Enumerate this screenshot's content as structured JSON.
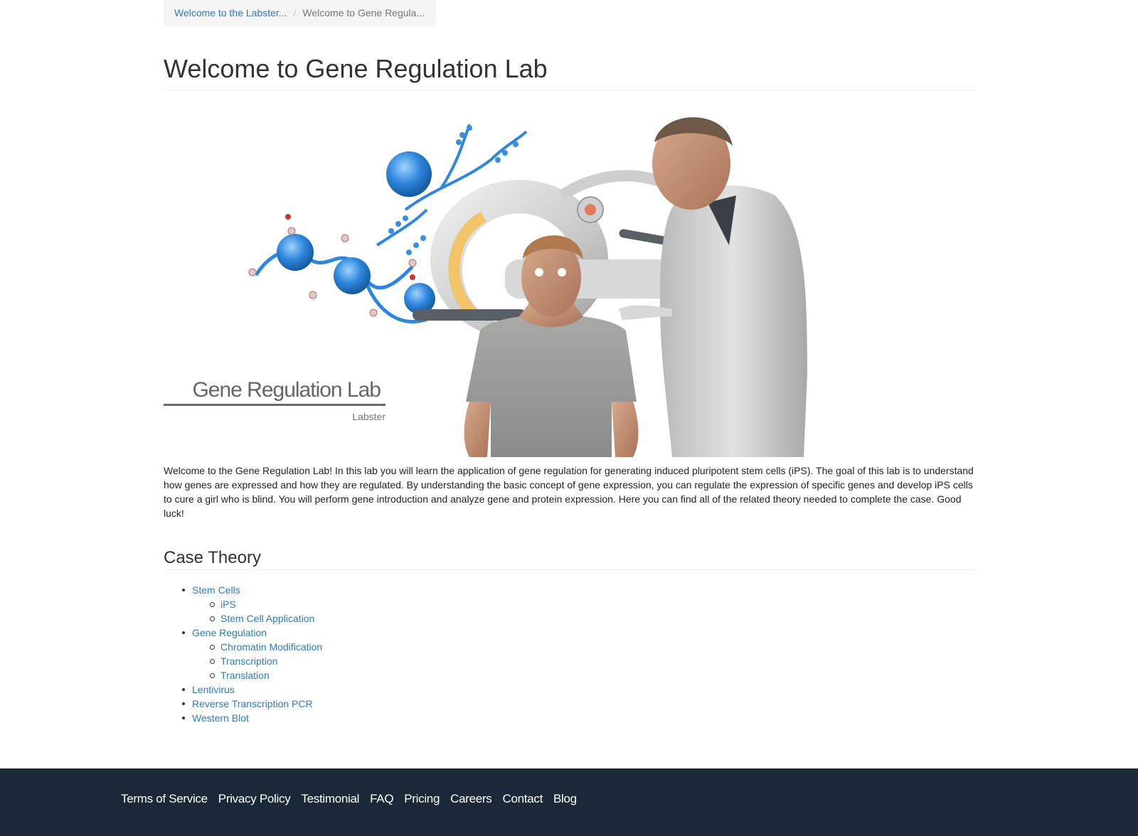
{
  "breadcrumb": {
    "items": [
      {
        "label": "Welcome to the Labster..."
      },
      {
        "label": "Welcome to Gene Regula..."
      }
    ]
  },
  "page": {
    "title": "Welcome to Gene Regulation Lab"
  },
  "hero": {
    "logo_title": "Gene Regulation Lab",
    "logo_subtitle": "Labster"
  },
  "intro": {
    "text": "Welcome to the Gene Regulation Lab! In this lab you will learn the application of gene regulation for generating induced pluripotent stem cells (iPS). The goal of this lab is to understand how genes are expressed and how they are regulated. By understanding the basic concept of gene expression, you can regulate the expression of specific genes and develop iPS cells to cure a girl who is blind. You will perform gene introduction and analyze gene and protein expression. Here you can find all of the related theory needed to complete the case. Good luck!"
  },
  "case_theory": {
    "title": "Case Theory",
    "items": [
      {
        "label": "Stem Cells",
        "children": [
          {
            "label": "iPS"
          },
          {
            "label": "Stem Cell Application"
          }
        ]
      },
      {
        "label": "Gene Regulation",
        "children": [
          {
            "label": "Chromatin Modification"
          },
          {
            "label": "Transcription"
          },
          {
            "label": "Translation"
          }
        ]
      },
      {
        "label": "Lentivirus"
      },
      {
        "label": "Reverse Transcription PCR"
      },
      {
        "label": "Western Blot"
      }
    ]
  },
  "footer": {
    "links": [
      "Terms of Service",
      "Privacy Policy",
      "Testimonial",
      "FAQ",
      "Pricing",
      "Careers",
      "Contact",
      "Blog"
    ],
    "bg_color": "#1a2838"
  },
  "colors": {
    "link": "#337ab7",
    "accent_blue": "#3a8fd9"
  }
}
